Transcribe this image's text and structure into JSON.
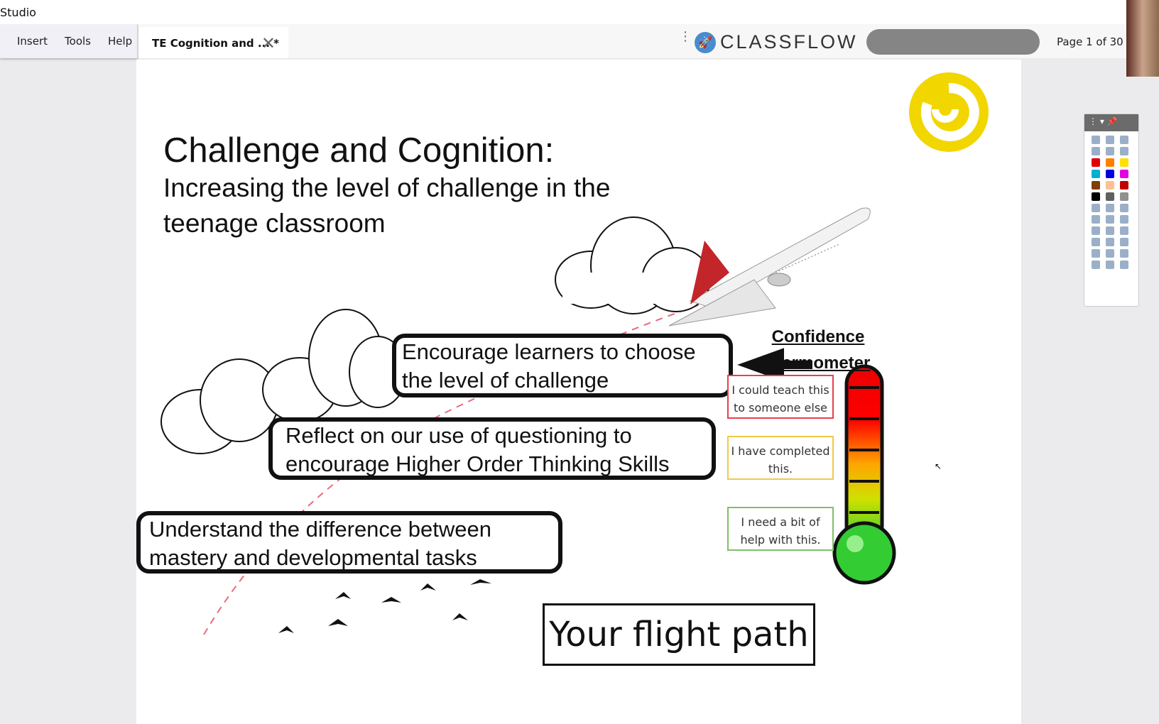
{
  "window": {
    "title": "Studio"
  },
  "menu": {
    "items": [
      "Insert",
      "Tools",
      "Help"
    ]
  },
  "tab": {
    "label": "TE Cognition and ... *",
    "close_icon": "close-icon"
  },
  "brand": {
    "name": "CLASSFLOW",
    "icon": "rocket-icon",
    "color": "#4a8bd0"
  },
  "pager": {
    "label": "Page 1 of 30"
  },
  "slide": {
    "title": "Challenge and Cognition:",
    "subtitle": "Increasing the level of challenge in the teenage classroom",
    "boxes": [
      "Encourage learners to choose the level of challenge",
      "Reflect on our use of questioning to encourage Higher Order Thinking Skills",
      "Understand the difference between mastery and developmental tasks"
    ],
    "thermometer_title": "Confidence thermometer",
    "levels": [
      {
        "text": "I could teach this to someone else",
        "color": "#e8404f"
      },
      {
        "text": "I have completed this.",
        "color": "#f2c84a"
      },
      {
        "text": "I need a bit of help with this.",
        "color": "#7fbf6a"
      }
    ],
    "flight_path": "Your flight path",
    "accent": "#f2d600"
  },
  "toolbar": {
    "colors": [
      "#e00000",
      "#ff8000",
      "#ffe000",
      "#00b0d0",
      "#0000e0",
      "#e000e0",
      "#804000",
      "#ffc090",
      "#c00000",
      "#000000",
      "#606060",
      "#909090"
    ]
  }
}
